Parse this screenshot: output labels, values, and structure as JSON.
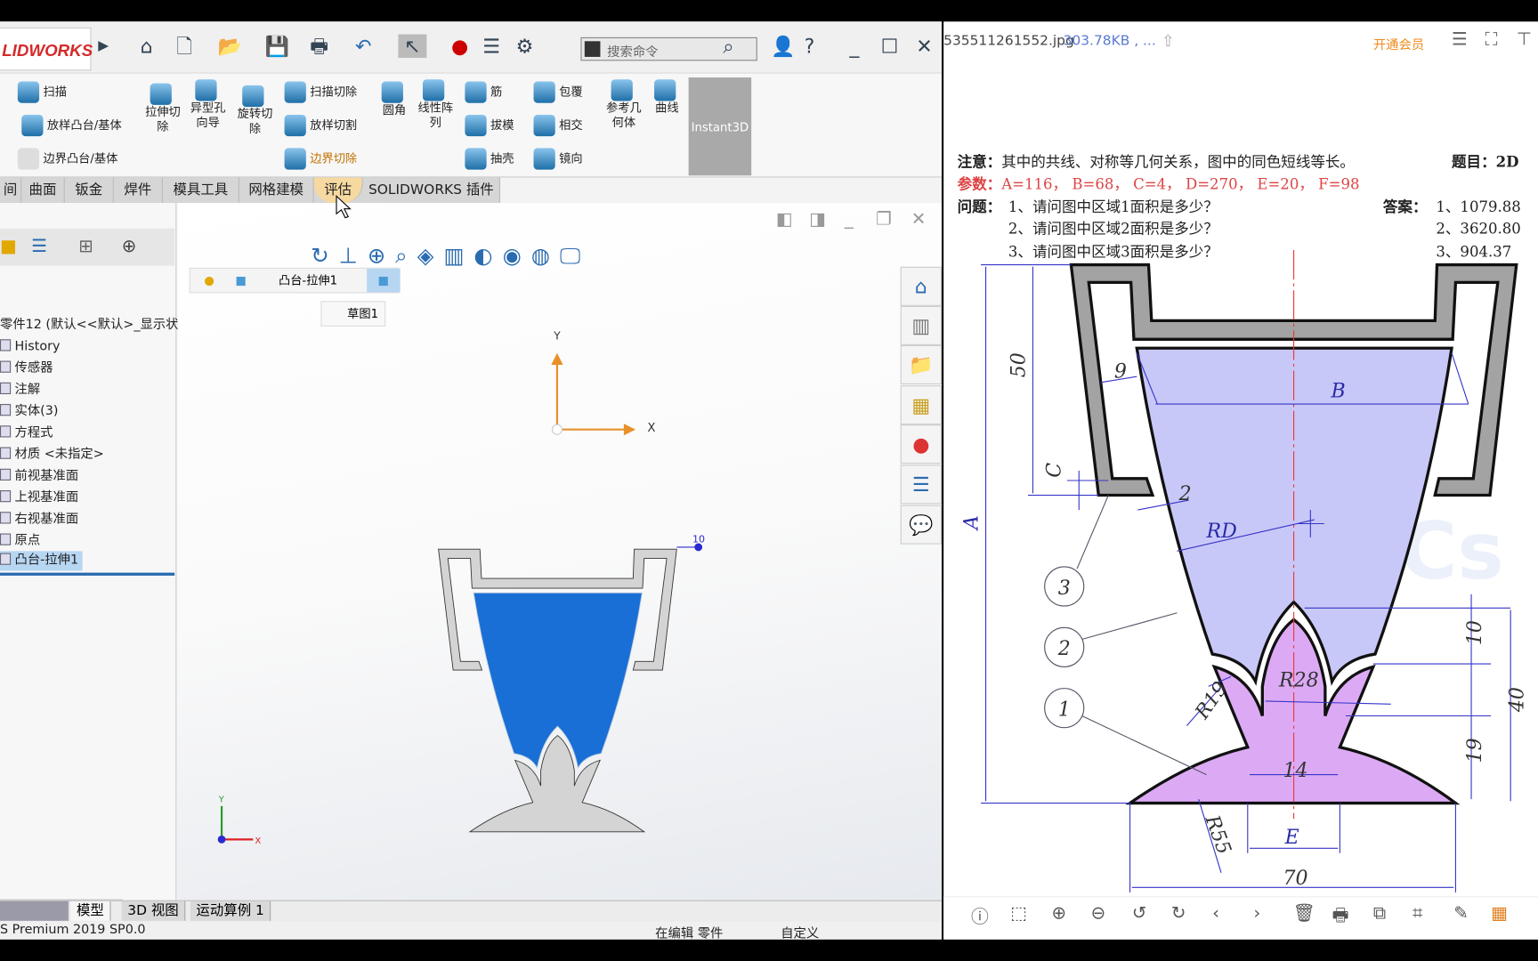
{
  "solidworks": {
    "logo": "LIDWORKS",
    "search_placeholder": "搜索命令",
    "ribbon": {
      "sweep": "扫描",
      "loft_boss": "放样凸台/基体",
      "boundary_boss": "边界凸台/基体",
      "extrude_cut": "拉伸切除",
      "hole_wizard": "异型孔向导",
      "revolve_cut": "旋转切除",
      "sweep_cut": "扫描切除",
      "loft_cut": "放样切割",
      "boundary_cut": "边界切除",
      "fillet": "圆角",
      "linear_pattern": "线性阵列",
      "rib": "筋",
      "draft": "拔模",
      "shell": "抽壳",
      "wrap": "包覆",
      "intersect": "相交",
      "mirror": "镜向",
      "ref_geometry": "参考几何体",
      "curves": "曲线",
      "instant3d": "Instant3D"
    },
    "tabs": [
      "间",
      "曲面",
      "钣金",
      "焊件",
      "模具工具",
      "网格建模",
      "评估",
      "SOLIDWORKS 插件"
    ],
    "active_tab": "评估",
    "tree": {
      "root": "零件12 (默认<<默认>_显示状",
      "items": [
        "History",
        "传感器",
        "注解",
        "实体(3)",
        "方程式",
        "材质 <未指定>",
        "前视基准面",
        "上视基准面",
        "右视基准面",
        "原点",
        "凸台-拉伸1"
      ],
      "selected": "凸台-拉伸1"
    },
    "breadcrumb": {
      "feature": "凸台-拉伸1",
      "sketch": "草图1"
    },
    "axes": {
      "x": "X",
      "y": "Y"
    },
    "dimension": "10",
    "bottom_tabs": [
      "模型",
      "3D 视图",
      "运动算例 1"
    ],
    "status": {
      "version": "S Premium 2019 SP0.0",
      "mode": "在编辑 零件",
      "units": "自定义"
    },
    "colors": {
      "cup": "#1a6fd6",
      "frame": "#d4d4d4",
      "accent": "#d42a2a"
    }
  },
  "viewer": {
    "filename": "535511261552.jpg",
    "filesize": "303.78KB , ...",
    "vip": "开通会员",
    "note_label": "注意：",
    "note": "其中的共线、对称等几何关系，图中的同色短线等长。",
    "title_label": "题目：2D",
    "params_label": "参数：",
    "params": "A=116，  B=68，  C=4，  D=270，  E=20，  F=98",
    "question_label": "问题：",
    "questions": [
      "1、请问图中区域1面积是多少？",
      "2、请问图中区域2面积是多少？",
      "3、请问图中区域3面积是多少？"
    ],
    "answer_label": "答案：",
    "answers": [
      "1、1079.88",
      "2、3620.80",
      "3、904.37"
    ],
    "drawing": {
      "dims": {
        "A": "A",
        "B": "B",
        "C": "C",
        "RD": "RD",
        "E": "E",
        "d50": "50",
        "d9": "9",
        "d2": "2",
        "R19": "R19",
        "R28": "R28",
        "d14": "14",
        "d10": "10",
        "d40": "40",
        "d19": "19",
        "R55": "R55",
        "d70": "70"
      },
      "regions": [
        "1",
        "2",
        "3"
      ],
      "watermark": "CaTICs",
      "colors": {
        "region2": "#c8c8f8",
        "region1": "#dcaaf5",
        "frame": "#a3a3a3",
        "dims": "#3434c8"
      }
    }
  }
}
